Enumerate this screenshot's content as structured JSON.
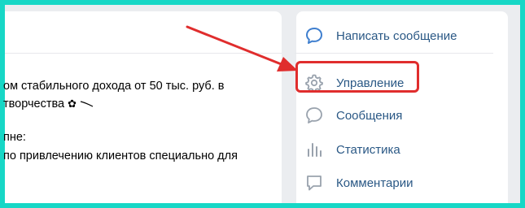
{
  "post": {
    "lines": [
      "ом стабильного дохода от 50 тыс. руб. в",
      "творчества",
      "пне:",
      "по привлечению клиентов специально для"
    ],
    "flower_icon": "✿"
  },
  "sidebar": {
    "items": [
      {
        "label": "Написать сообщение",
        "icon": "speech-bubble-icon"
      },
      {
        "label": "Управление",
        "icon": "gear-icon"
      },
      {
        "label": "Сообщения",
        "icon": "message-icon"
      },
      {
        "label": "Статистика",
        "icon": "bar-chart-icon"
      },
      {
        "label": "Комментарии",
        "icon": "comment-icon"
      }
    ]
  },
  "colors": {
    "frame": "#17d7c6",
    "background": "#ebedf0",
    "link": "#2a5885",
    "highlight": "#e02d2d"
  }
}
